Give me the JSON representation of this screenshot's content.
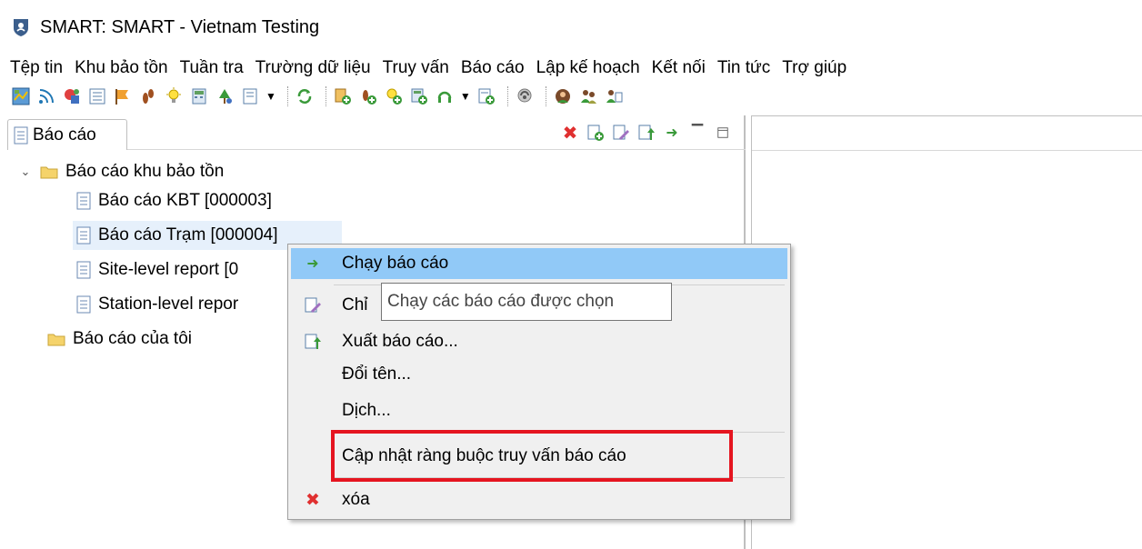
{
  "window": {
    "title": "SMART: SMART - Vietnam Testing"
  },
  "menubar": {
    "items": [
      "Tệp tin",
      "Khu bảo tồn",
      "Tuần tra",
      "Trường dữ liệu",
      "Truy vấn",
      "Báo cáo",
      "Lập kế hoạch",
      "Kết nối",
      "Tin tức",
      "Trợ giúp"
    ]
  },
  "panel": {
    "tab_label": "Báo cáo"
  },
  "tree": {
    "root_folder": "Báo cáo khu bảo tồn",
    "items": [
      "Báo cáo KBT [000003]",
      "Báo cáo Trạm [000004]",
      "Site-level report [0",
      "Station-level repor"
    ],
    "my_folder": "Báo cáo của tôi"
  },
  "context_menu": {
    "run": "Chạy báo cáo",
    "edit": "Chỉ",
    "export": "Xuất báo cáo...",
    "rename": "Đổi tên...",
    "translate": "Dịch...",
    "update_constraints": "Cập nhật ràng buộc truy vấn báo cáo",
    "delete": "xóa"
  },
  "tooltip": {
    "text": "Chạy các báo cáo được chọn"
  },
  "colors": {
    "highlight": "#91c9f7",
    "annotation": "#e51520",
    "selected_row": "#e6f0fb"
  }
}
